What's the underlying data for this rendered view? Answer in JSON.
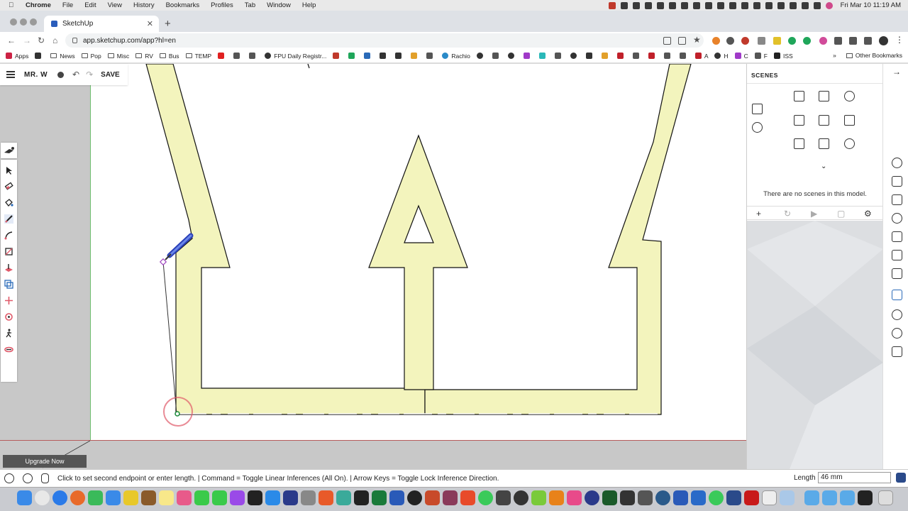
{
  "menubar": {
    "app": "Chrome",
    "items": [
      "File",
      "Edit",
      "View",
      "History",
      "Bookmarks",
      "Profiles",
      "Tab",
      "Window",
      "Help"
    ],
    "clock": "Fri Mar 10  11:19 AM"
  },
  "browser": {
    "tab_title": "SketchUp",
    "url": "app.sketchup.com/app?hl=en"
  },
  "bookmarks": {
    "items": [
      {
        "label": "Apps",
        "icon": "apps-grid-icon"
      },
      {
        "label": "",
        "icon": "home-icon"
      },
      {
        "label": "News",
        "icon": "folder-icon"
      },
      {
        "label": "Pop",
        "icon": "folder-icon"
      },
      {
        "label": "Misc",
        "icon": "folder-icon"
      },
      {
        "label": "RV",
        "icon": "folder-icon"
      },
      {
        "label": "Bus",
        "icon": "folder-icon"
      },
      {
        "label": "TEMP",
        "icon": "folder-icon"
      },
      {
        "label": "FPU Daily Registr...",
        "icon": "site-icon"
      },
      {
        "label": "Rachio",
        "icon": "site-icon"
      },
      {
        "label": "A",
        "icon": "site-icon"
      },
      {
        "label": "H",
        "icon": "site-icon"
      },
      {
        "label": "C",
        "icon": "site-icon"
      },
      {
        "label": "F",
        "icon": "site-icon"
      },
      {
        "label": "ISS",
        "icon": "site-icon"
      }
    ],
    "overflow": "»",
    "other": "Other Bookmarks"
  },
  "app": {
    "user": "MR. W",
    "save_label": "SAVE",
    "upgrade_label": "Upgrade Now"
  },
  "scenes": {
    "title": "SCENES",
    "empty_message": "There are no scenes in this model."
  },
  "statusbar": {
    "message": "Click to set second endpoint or enter length. | Command = Toggle Linear Inferences (All On). | Arrow Keys = Toggle Lock Inference Direction.",
    "length_label": "Length",
    "length_value": "46 mm"
  },
  "colors": {
    "shape_fill": "#f3f4bd",
    "accent_blue": "#3a5ccc",
    "inference_red": "#e05a6a"
  }
}
